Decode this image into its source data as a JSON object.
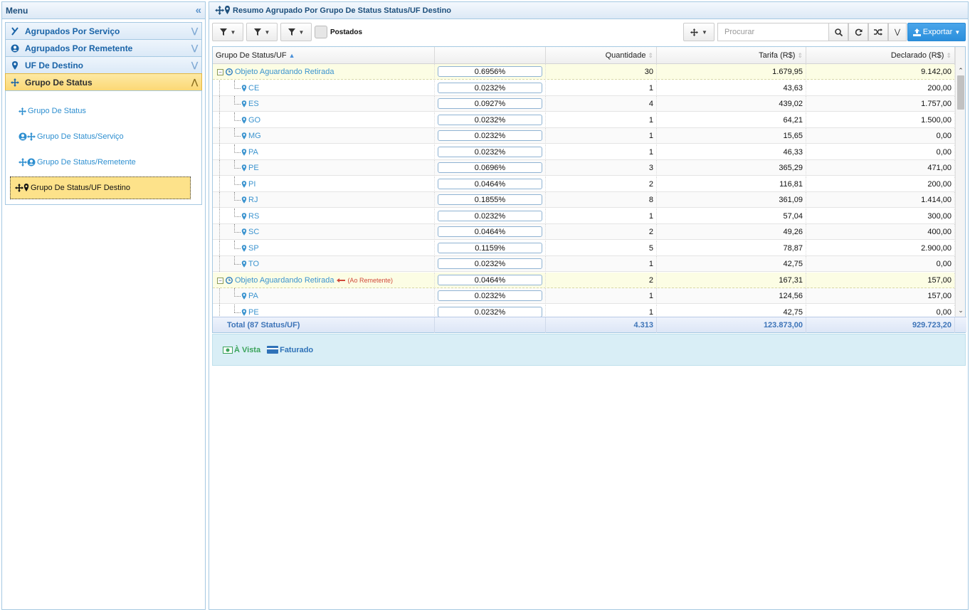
{
  "menu": {
    "title": "Menu",
    "accordion": [
      {
        "label": "Agrupados Por Serviço",
        "icon": "branch-icon"
      },
      {
        "label": "Agrupados Por Remetente",
        "icon": "user-circle-icon"
      },
      {
        "label": "UF De Destino",
        "icon": "map-marker-icon"
      },
      {
        "label": "Grupo De Status",
        "icon": "arrows-move-icon",
        "active": true
      }
    ],
    "sub_items": [
      {
        "label": "Grupo De Status",
        "icon": "arrows-move-icon"
      },
      {
        "label": "Grupo De Status/Serviço",
        "icon": "user-arrows-icon"
      },
      {
        "label": "Grupo De Status/Remetente",
        "icon": "arrows-user-icon"
      },
      {
        "label": "Grupo De Status/UF Destino",
        "icon": "arrows-marker-icon",
        "selected": true
      }
    ]
  },
  "main": {
    "title": "Resumo Agrupado Por Grupo De Status Status/UF Destino",
    "toolbar": {
      "checkbox_label": "Postados",
      "search_placeholder": "Procurar",
      "export_label": "Exportar"
    },
    "columns": {
      "group": "Grupo De Status/UF",
      "percent": "",
      "qty": "Quantidade",
      "tarifa": "Tarifa (R$)",
      "declarado": "Declarado (R$)"
    },
    "rows": [
      {
        "type": "group",
        "label": "Objeto Aguardando Retirada",
        "note": "",
        "percent": "0.6956%",
        "qty": "30",
        "tarifa": "1.679,95",
        "declarado": "9.142,00"
      },
      {
        "type": "child",
        "label": "CE",
        "percent": "0.0232%",
        "qty": "1",
        "tarifa": "43,63",
        "declarado": "200,00"
      },
      {
        "type": "child",
        "label": "ES",
        "percent": "0.0927%",
        "qty": "4",
        "tarifa": "439,02",
        "declarado": "1.757,00"
      },
      {
        "type": "child",
        "label": "GO",
        "percent": "0.0232%",
        "qty": "1",
        "tarifa": "64,21",
        "declarado": "1.500,00"
      },
      {
        "type": "child",
        "label": "MG",
        "percent": "0.0232%",
        "qty": "1",
        "tarifa": "15,65",
        "declarado": "0,00"
      },
      {
        "type": "child",
        "label": "PA",
        "percent": "0.0232%",
        "qty": "1",
        "tarifa": "46,33",
        "declarado": "0,00"
      },
      {
        "type": "child",
        "label": "PE",
        "percent": "0.0696%",
        "qty": "3",
        "tarifa": "365,29",
        "declarado": "471,00"
      },
      {
        "type": "child",
        "label": "PI",
        "percent": "0.0464%",
        "qty": "2",
        "tarifa": "116,81",
        "declarado": "200,00"
      },
      {
        "type": "child",
        "label": "RJ",
        "percent": "0.1855%",
        "qty": "8",
        "tarifa": "361,09",
        "declarado": "1.414,00"
      },
      {
        "type": "child",
        "label": "RS",
        "percent": "0.0232%",
        "qty": "1",
        "tarifa": "57,04",
        "declarado": "300,00"
      },
      {
        "type": "child",
        "label": "SC",
        "percent": "0.0464%",
        "qty": "2",
        "tarifa": "49,26",
        "declarado": "400,00"
      },
      {
        "type": "child",
        "label": "SP",
        "percent": "0.1159%",
        "qty": "5",
        "tarifa": "78,87",
        "declarado": "2.900,00"
      },
      {
        "type": "child",
        "label": "TO",
        "percent": "0.0232%",
        "qty": "1",
        "tarifa": "42,75",
        "declarado": "0,00",
        "last": true
      },
      {
        "type": "group",
        "label": "Objeto Aguardando Retirada",
        "note": "(Ao Remetente)",
        "percent": "0.0464%",
        "qty": "2",
        "tarifa": "167,31",
        "declarado": "157,00"
      },
      {
        "type": "child",
        "label": "PA",
        "percent": "0.0232%",
        "qty": "1",
        "tarifa": "124,56",
        "declarado": "157,00"
      },
      {
        "type": "child",
        "label": "PE",
        "percent": "0.0232%",
        "qty": "1",
        "tarifa": "42,75",
        "declarado": "0,00",
        "last": true
      }
    ],
    "footer": {
      "label": "Total (87 Status/UF)",
      "qty": "4.313",
      "tarifa": "123.873,00",
      "declarado": "929.723,20"
    },
    "legend": [
      {
        "label": "À Vista",
        "icon": "money-icon",
        "color": "#3aa35a"
      },
      {
        "label": "Faturado",
        "icon": "credit-card-icon",
        "color": "#2f72b8"
      }
    ]
  }
}
